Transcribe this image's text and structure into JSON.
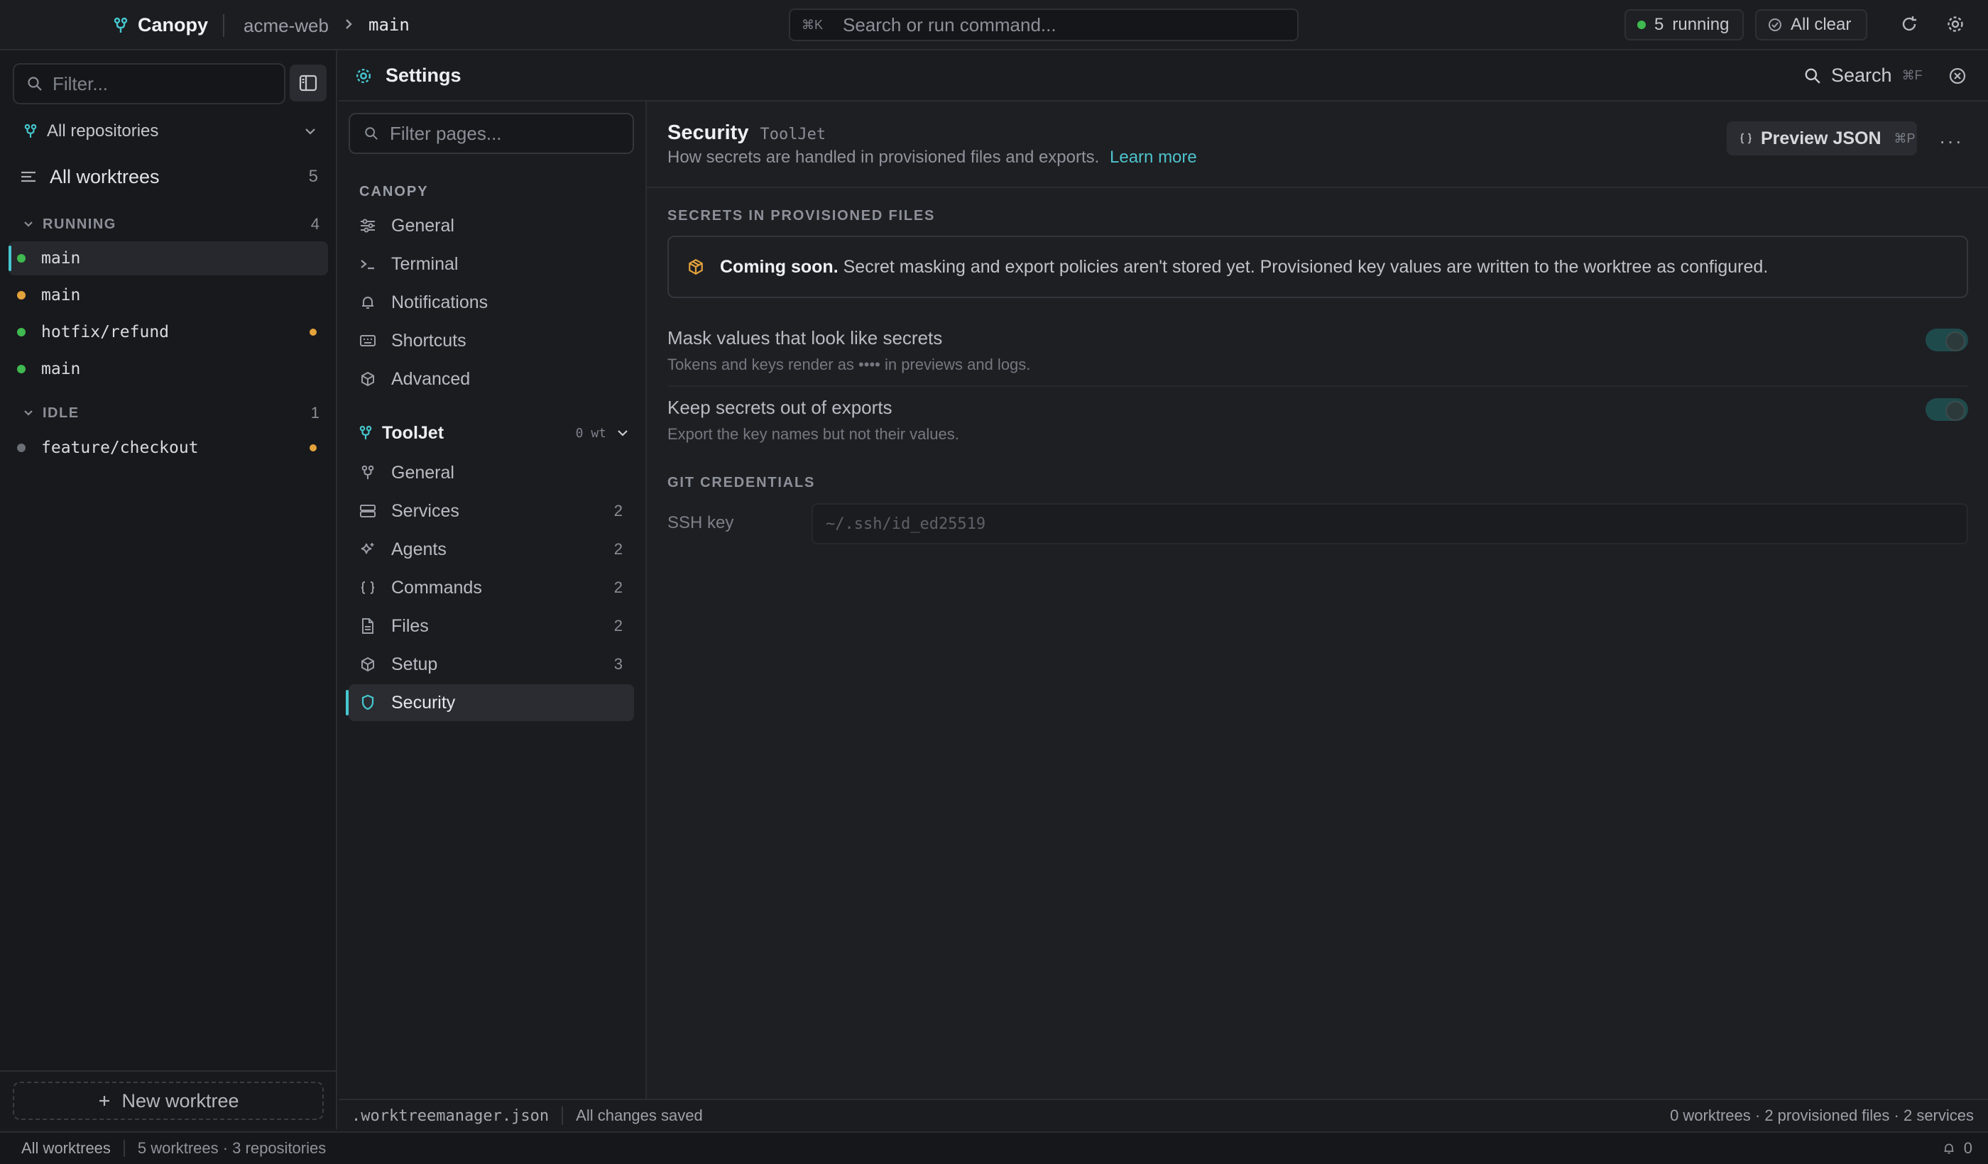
{
  "topbar": {
    "app_name": "Canopy",
    "repo": "acme-web",
    "branch": "main",
    "command_shortcut": "⌘K",
    "command_placeholder": "Search or run command...",
    "running_count": "5",
    "running_label": "running",
    "status_label": "All clear"
  },
  "sidebar": {
    "filter_placeholder": "Filter...",
    "repo_select": "All repositories",
    "all_worktrees_label": "All worktrees",
    "all_worktrees_count": "5",
    "groups": [
      {
        "label": "RUNNING",
        "count": "4",
        "items": [
          {
            "name": "main",
            "status": "green",
            "active": true
          },
          {
            "name": "main",
            "status": "amber"
          },
          {
            "name": "hotfix/refund",
            "status": "green",
            "changes": true
          },
          {
            "name": "main",
            "status": "green"
          }
        ]
      },
      {
        "label": "IDLE",
        "count": "1",
        "items": [
          {
            "name": "feature/checkout",
            "status": "grey",
            "changes": true
          }
        ]
      }
    ],
    "new_worktree_label": "New worktree"
  },
  "settings_header": {
    "title": "Settings",
    "search_label": "Search",
    "search_shortcut": "⌘F"
  },
  "settings_nav": {
    "filter_placeholder": "Filter pages...",
    "canopy_section": "CANOPY",
    "canopy_items": [
      {
        "label": "General",
        "icon": "sliders-icon"
      },
      {
        "label": "Terminal",
        "icon": "terminal-icon"
      },
      {
        "label": "Notifications",
        "icon": "bell-icon"
      },
      {
        "label": "Shortcuts",
        "icon": "keyboard-icon"
      },
      {
        "label": "Advanced",
        "icon": "cube-icon"
      }
    ],
    "project_name": "ToolJet",
    "project_wt": "0 wt",
    "project_items": [
      {
        "label": "General",
        "icon": "branch-icon",
        "count": ""
      },
      {
        "label": "Services",
        "icon": "server-icon",
        "count": "2"
      },
      {
        "label": "Agents",
        "icon": "sparkle-icon",
        "count": "2"
      },
      {
        "label": "Commands",
        "icon": "braces-icon",
        "count": "2"
      },
      {
        "label": "Files",
        "icon": "file-icon",
        "count": "2"
      },
      {
        "label": "Setup",
        "icon": "cube-icon",
        "count": "3"
      },
      {
        "label": "Security",
        "icon": "shield-icon",
        "count": "",
        "active": true
      }
    ]
  },
  "content": {
    "title": "Security",
    "project_tag": "ToolJet",
    "description": "How secrets are handled in provisioned files and exports.",
    "learn_more": "Learn more",
    "preview_label": "Preview JSON",
    "preview_shortcut": "⌘P",
    "more_label": "···",
    "section_secrets": "SECRETS IN PROVISIONED FILES",
    "notice_strong": "Coming soon.",
    "notice_text": "Secret masking and export policies aren't stored yet. Provisioned key values are written to the worktree as configured.",
    "settings": [
      {
        "label": "Mask values that look like secrets",
        "hint": "Tokens and keys render as •••• in previews and logs.",
        "enabled": true
      },
      {
        "label": "Keep secrets out of exports",
        "hint": "Export the key names but not their values.",
        "enabled": true
      }
    ],
    "section_git": "GIT CREDENTIALS",
    "ssh_label": "SSH key",
    "ssh_placeholder": "~/.ssh/id_ed25519"
  },
  "content_footer": {
    "file": ".worktreemanager.json",
    "save_status": "All changes saved",
    "summary": "0 worktrees · 2 provisioned files · 2 services"
  },
  "statusbar": {
    "scope": "All worktrees",
    "summary": "5 worktrees · 3 repositories",
    "notifications": "0"
  },
  "colors": {
    "accent": "#46c7cf",
    "running": "#3fb950",
    "warning": "#e3a33b",
    "idle": "#6b6f77"
  }
}
